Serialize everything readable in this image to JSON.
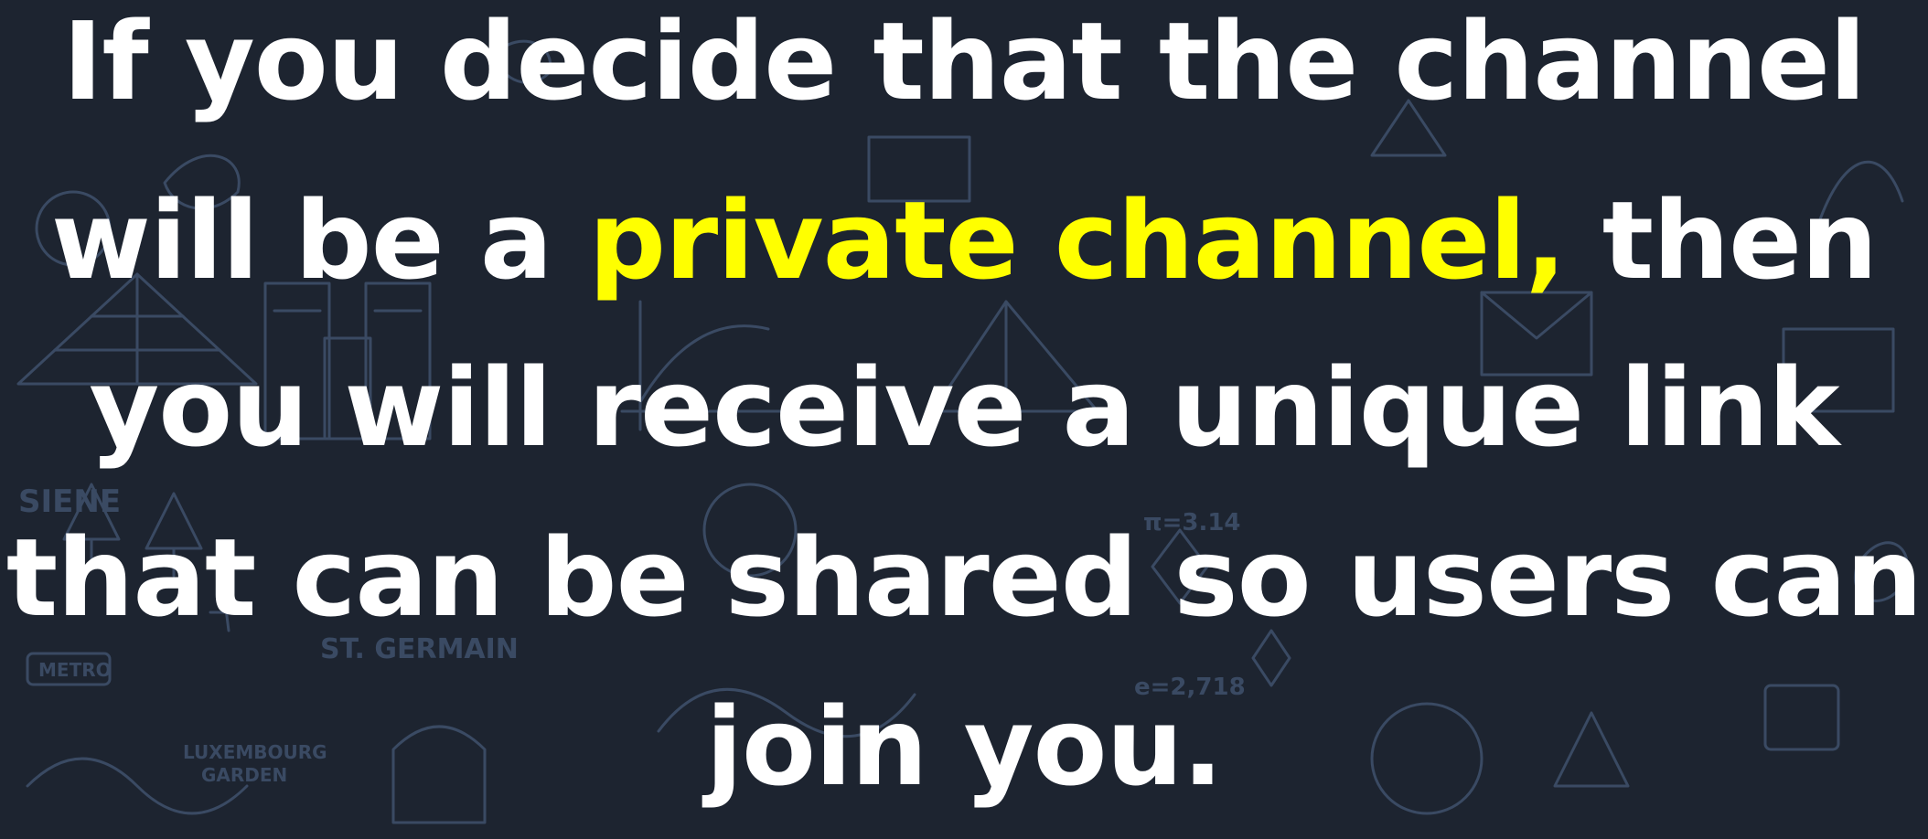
{
  "colors": {
    "background": "#1d2430",
    "doodle_stroke": "#3a4a63",
    "text": "#ffffff",
    "highlight": "#ffff00"
  },
  "background_labels": {
    "siene": "SIENE",
    "metro": "METRO",
    "luxembourg": "LUXEMBOURG",
    "garden": "GARDEN",
    "germain": "ST. GERMAIN",
    "pi": "π=3.14",
    "euler": "e=2,718"
  },
  "caption": {
    "line1": "If you decide that the channel",
    "line2_before": "will be a ",
    "line2_highlight": "private channel,",
    "line2_after": " then",
    "line3": "you will receive a unique link",
    "line4": "that can be shared so users can",
    "line5": "join you."
  }
}
